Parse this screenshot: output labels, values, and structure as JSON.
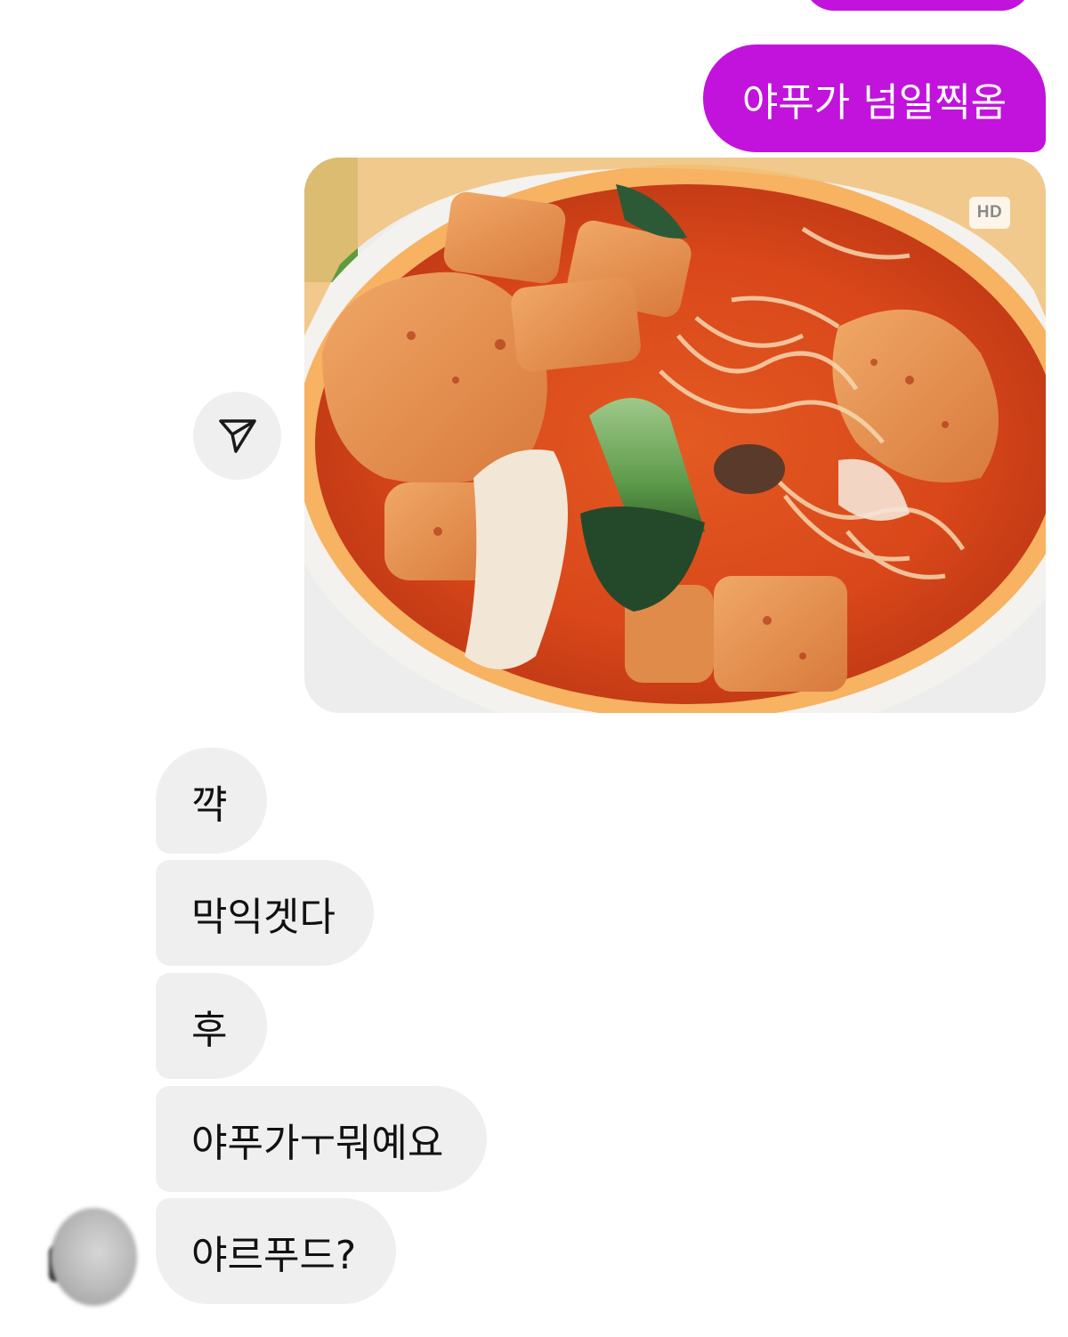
{
  "sent_messages": [
    {
      "text": ""
    },
    {
      "text": "야푸가 넘일찍옴"
    }
  ],
  "photo": {
    "badge": "HD"
  },
  "received_messages": [
    {
      "text": "꺅"
    },
    {
      "text": "막익겟다"
    },
    {
      "text": "후"
    },
    {
      "text": "야푸가ㅜ뭐예요"
    },
    {
      "text": "야르푸드?"
    }
  ],
  "colors": {
    "sent_bubble": "#c113dc",
    "received_bubble": "#efefef",
    "background": "#ffffff"
  },
  "icons": {
    "share": "send-icon",
    "avatar": "avatar-blurred"
  }
}
